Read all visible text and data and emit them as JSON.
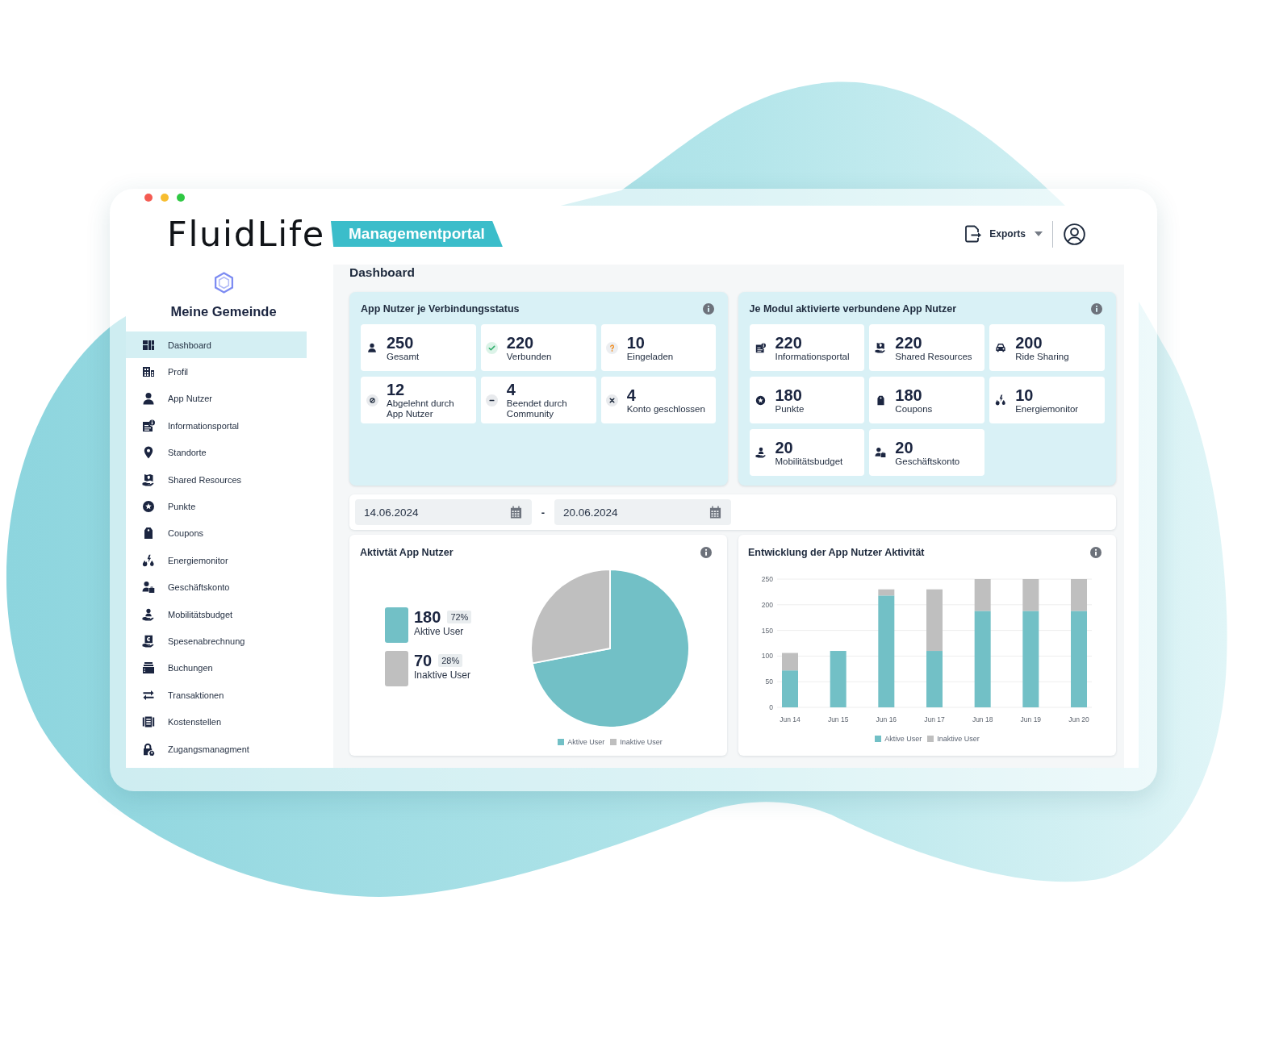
{
  "header": {
    "logo": "FluidLife",
    "portal": "Managementportal",
    "exports_button": "Exports"
  },
  "sidebar": {
    "organization": "Meine Gemeinde",
    "items": [
      {
        "label": "Dashboard",
        "selected": true
      },
      {
        "label": "Profil",
        "selected": false
      },
      {
        "label": "App Nutzer",
        "selected": false
      },
      {
        "label": "Informationsportal",
        "selected": false
      },
      {
        "label": "Standorte",
        "selected": false
      },
      {
        "label": "Shared Resources",
        "selected": false
      },
      {
        "label": "Punkte",
        "selected": false
      },
      {
        "label": "Coupons",
        "selected": false
      },
      {
        "label": "Energiemonitor",
        "selected": false
      },
      {
        "label": "Geschäftskonto",
        "selected": false
      },
      {
        "label": "Mobilitätsbudget",
        "selected": false
      },
      {
        "label": "Spesenabrechnung",
        "selected": false
      },
      {
        "label": "Buchungen",
        "selected": false
      },
      {
        "label": "Transaktionen",
        "selected": false
      },
      {
        "label": "Kostenstellen",
        "selected": false
      },
      {
        "label": "Zugangsmanagment",
        "selected": false
      }
    ]
  },
  "page_title": "Dashboard",
  "connection_status": {
    "title": "App Nutzer je Verbindungsstatus",
    "tiles": [
      {
        "value": "250",
        "label": "Gesamt"
      },
      {
        "value": "220",
        "label": "Verbunden"
      },
      {
        "value": "10",
        "label": "Eingeladen"
      },
      {
        "value": "12",
        "label": "Abgelehnt durch App Nutzer"
      },
      {
        "value": "4",
        "label": "Beendet durch Community"
      },
      {
        "value": "4",
        "label": "Konto geschlossen"
      }
    ]
  },
  "module_users": {
    "title": "Je Modul aktivierte verbundene App Nutzer",
    "tiles": [
      {
        "value": "220",
        "label": "Informationsportal"
      },
      {
        "value": "220",
        "label": "Shared Resources"
      },
      {
        "value": "200",
        "label": "Ride Sharing"
      },
      {
        "value": "180",
        "label": "Punkte"
      },
      {
        "value": "180",
        "label": "Coupons"
      },
      {
        "value": "10",
        "label": "Energiemonitor"
      },
      {
        "value": "20",
        "label": "Mobilitätsbudget"
      },
      {
        "value": "20",
        "label": "Geschäftskonto"
      }
    ]
  },
  "date_range": {
    "start": "14.06.2024",
    "separator": "-",
    "end": "20.06.2024"
  },
  "activity": {
    "title": "Aktivtät App Nutzer",
    "summary": [
      {
        "value": "180",
        "percent": "72%",
        "label": "Aktive User",
        "color": "#72c0c6"
      },
      {
        "value": "70",
        "percent": "28%",
        "label": "Inaktive User",
        "color": "#bfbfbf"
      }
    ],
    "chart_data": {
      "type": "pie",
      "categories": [
        "Aktive User",
        "Inaktive User"
      ],
      "values": [
        72,
        28
      ],
      "legend": "bottom"
    }
  },
  "activity_trend": {
    "title": "Entwicklung der App Nutzer Aktivität",
    "chart_data": {
      "type": "bar",
      "stacked": true,
      "categories": [
        "Jun 14",
        "Jun 15",
        "Jun 16",
        "Jun 17",
        "Jun 18",
        "Jun 19",
        "Jun 20"
      ],
      "series": [
        {
          "name": "Aktive User",
          "color": "#72c0c6",
          "values": [
            72,
            110,
            218,
            110,
            188,
            188,
            188
          ]
        },
        {
          "name": "Inaktive User",
          "color": "#bfbfbf",
          "values": [
            34,
            0,
            12,
            120,
            62,
            62,
            62
          ]
        }
      ],
      "ylim": [
        0,
        250
      ],
      "yticks": [
        0,
        50,
        100,
        150,
        200,
        250
      ],
      "grid": true,
      "legend": "bottom"
    }
  }
}
